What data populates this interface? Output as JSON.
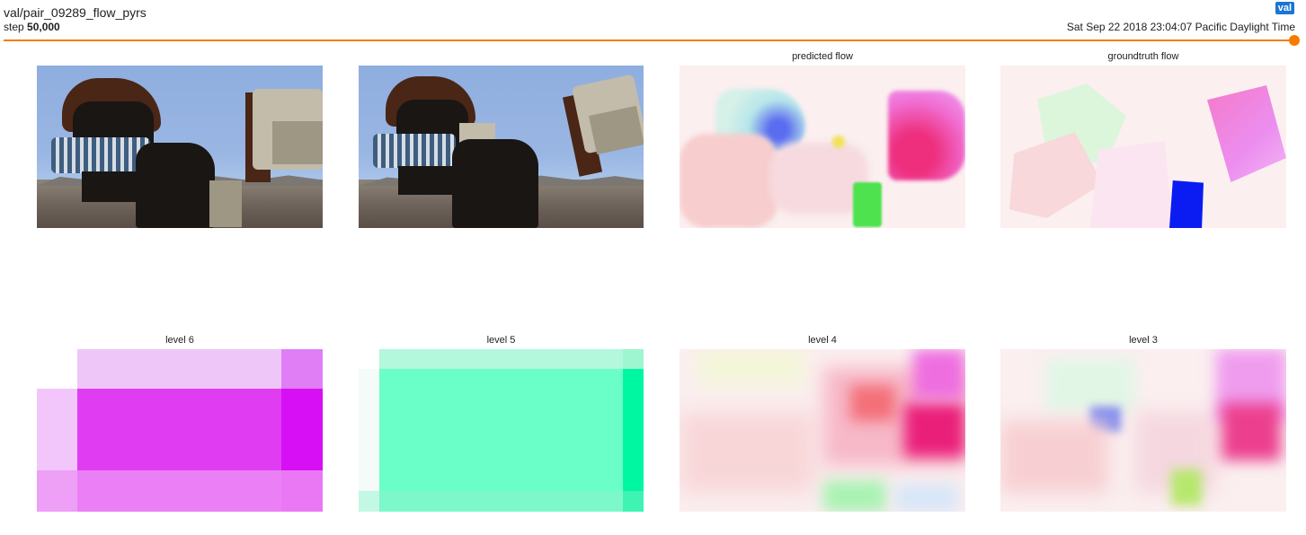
{
  "header": {
    "tag": "val/pair_09289_flow_pyrs",
    "step_label": "step",
    "step_value": "50,000",
    "timestamp": "Sat Sep 22 2018 23:04:07 Pacific Daylight Time",
    "run_badge": "val"
  },
  "colors": {
    "accent": "#f57c00",
    "badge": "#1976d2"
  },
  "panels": {
    "frame_a": {
      "caption": ""
    },
    "frame_b": {
      "caption": ""
    },
    "predicted": {
      "caption": "predicted flow"
    },
    "groundtruth": {
      "caption": "groundtruth flow"
    },
    "level6": {
      "caption": "level 6"
    },
    "level5": {
      "caption": "level 5"
    },
    "level4": {
      "caption": "level 4"
    },
    "level3": {
      "caption": "level 3"
    }
  }
}
